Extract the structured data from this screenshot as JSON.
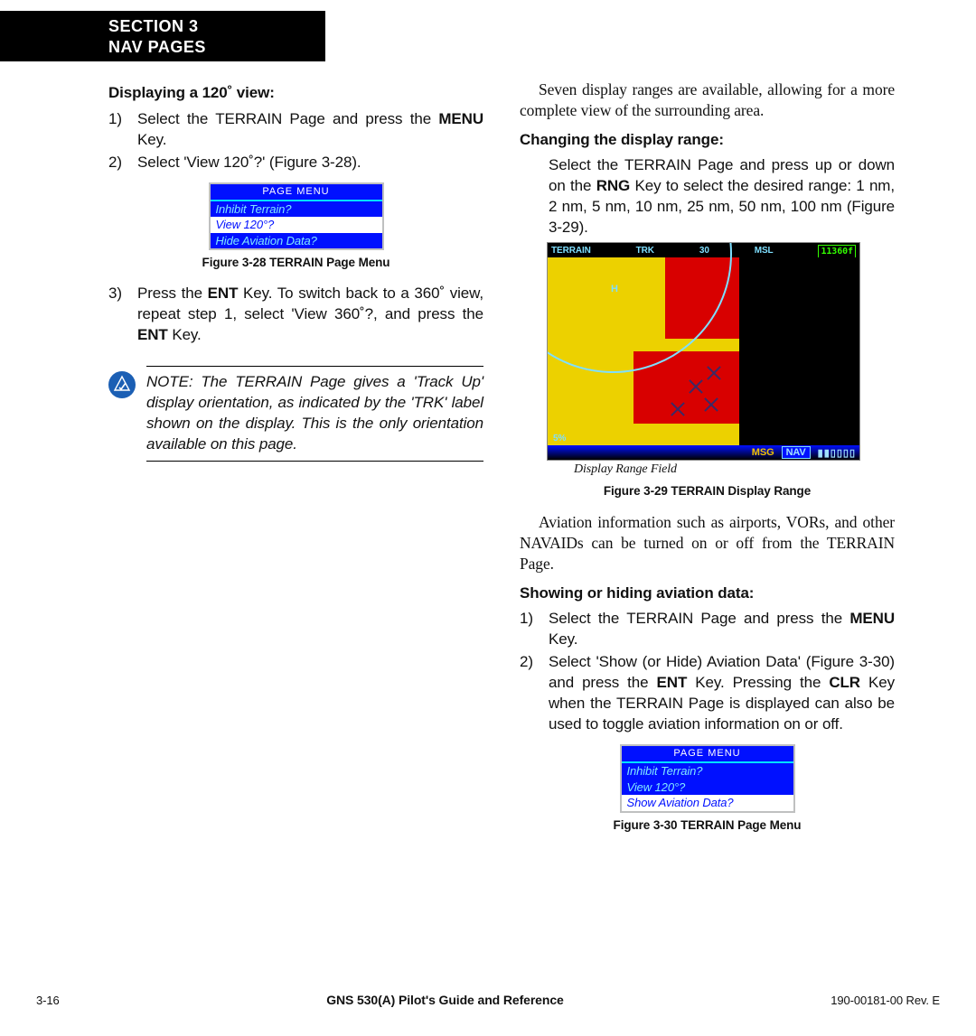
{
  "header": {
    "line1": "SECTION 3",
    "line2": "NAV PAGES"
  },
  "left": {
    "heading1": "Displaying a 120˚ view:",
    "step1": {
      "num": "1)",
      "pre": "Select the TERRAIN Page and press the ",
      "bold": "MENU",
      "post": " Key."
    },
    "step2": {
      "num": "2)",
      "text": "Select 'View 120˚?' (Figure 3-28)."
    },
    "menu328": {
      "title": "PAGE MENU",
      "row1": "Inhibit Terrain?",
      "row2": "View 120°?",
      "row3": "Hide Aviation Data?"
    },
    "fig328": "Figure 3-28  TERRAIN Page Menu",
    "step3": {
      "num": "3)",
      "p1": "Press the ",
      "b1": "ENT",
      "p2": " Key.  To switch back to a 360˚ view, repeat step 1, select 'View 360˚?, and press the ",
      "b2": "ENT",
      "p3": " Key."
    },
    "note": "NOTE:  The TERRAIN Page gives a 'Track Up' display orientation, as indicated by the 'TRK' label shown on the display.  This is the only orientation available on this page."
  },
  "right": {
    "para1": "Seven display ranges are available, allowing for a more complete view of the surrounding area.",
    "heading2": "Changing the display range:",
    "range_step": {
      "pre": "Select the TERRAIN Page and press up or down on the ",
      "b": "RNG",
      "post": " Key to select the desired range: 1 nm, 2 nm, 5 nm, 10 nm, 25 nm, 50 nm, 100 nm (Figure 3-29)."
    },
    "terrain_labels": {
      "tl": "TERRAIN",
      "trk": "TRK",
      "hdg": "30",
      "msl": "MSL",
      "alt": "11360f",
      "h": "H",
      "msg": "MSG",
      "nav": "NAV",
      "bars": "▮▮▯▯▯▯",
      "five": "5%"
    },
    "range_anno": "Display Range Field",
    "fig329": "Figure 3-29  TERRAIN Display Range",
    "para2": "Aviation information such as airports, VORs, and other NAVAIDs can be turned on or off from the TERRAIN Page.",
    "heading3": "Showing or hiding aviation data:",
    "av1": {
      "num": "1)",
      "pre": "Select the TERRAIN Page and press the ",
      "b": "MENU",
      "post": " Key."
    },
    "av2": {
      "num": "2)",
      "p1": "Select 'Show (or Hide) Aviation Data' (Figure 3-30) and press the ",
      "b1": "ENT",
      "p2": " Key.  Pressing the ",
      "b2": "CLR",
      "p3": " Key when the  TERRAIN Page is displayed can also be used to toggle aviation information on or off."
    },
    "menu330": {
      "title": "PAGE MENU",
      "row1": "Inhibit Terrain?",
      "row2": "View 120°?",
      "row3": "Show Aviation Data?"
    },
    "fig330": "Figure 3-30  TERRAIN Page Menu"
  },
  "footer": {
    "page": "3-16",
    "doc": "GNS 530(A) Pilot's Guide and Reference",
    "rev": "190-00181-00  Rev. E"
  }
}
